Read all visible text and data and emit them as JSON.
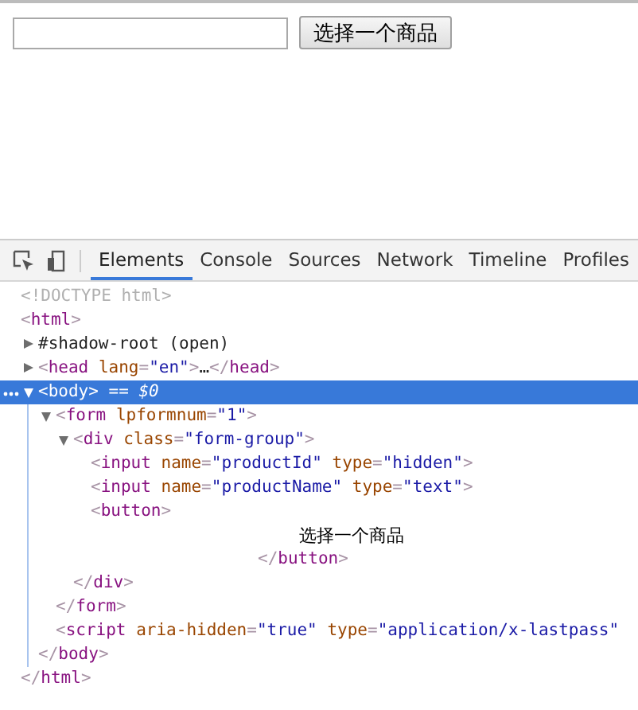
{
  "page": {
    "button": "选择一个商品"
  },
  "devtools": {
    "tabs": [
      {
        "label": "Elements",
        "selected": true
      },
      {
        "label": "Console",
        "selected": false
      },
      {
        "label": "Sources",
        "selected": false
      },
      {
        "label": "Network",
        "selected": false
      },
      {
        "label": "Timeline",
        "selected": false
      },
      {
        "label": "Profiles",
        "selected": false
      }
    ],
    "tree": [
      {
        "kind": "doctype",
        "selected": false,
        "text": "<!DOCTYPE html>"
      },
      {
        "kind": "element",
        "selected": false,
        "open": [
          {
            "kind": "punct",
            "text": "<"
          },
          {
            "kind": "tag",
            "text": "html"
          },
          {
            "kind": "punct",
            "text": ">"
          }
        ],
        "close": [
          {
            "kind": "punct",
            "text": "</"
          },
          {
            "kind": "tag",
            "text": "html"
          },
          {
            "kind": "punct",
            "text": ">"
          }
        ],
        "children": [
          {
            "kind": "shadow",
            "expanded": false,
            "selected": false,
            "text": "#shadow-root (open)"
          },
          {
            "kind": "element",
            "expanded": false,
            "selected": false,
            "open": [
              {
                "kind": "punct",
                "text": "<"
              },
              {
                "kind": "tag",
                "text": "head"
              },
              {
                "kind": "attr",
                "text": " lang"
              },
              {
                "kind": "punct",
                "text": "="
              },
              {
                "kind": "value",
                "text": "\"en\""
              },
              {
                "kind": "punct",
                "text": ">"
              },
              {
                "kind": "plain",
                "text": "…"
              },
              {
                "kind": "punct",
                "text": "</"
              },
              {
                "kind": "tag",
                "text": "head"
              },
              {
                "kind": "punct",
                "text": ">"
              }
            ]
          },
          {
            "kind": "element",
            "expanded": true,
            "selected": true,
            "suffix": " == $0",
            "open": [
              {
                "kind": "punct",
                "text": "<"
              },
              {
                "kind": "tag",
                "text": "body"
              },
              {
                "kind": "punct",
                "text": ">"
              }
            ],
            "close": [
              {
                "kind": "punct",
                "text": "</"
              },
              {
                "kind": "tag",
                "text": "body"
              },
              {
                "kind": "punct",
                "text": ">"
              }
            ],
            "children": [
              {
                "kind": "element",
                "expanded": true,
                "selected": false,
                "open": [
                  {
                    "kind": "punct",
                    "text": "<"
                  },
                  {
                    "kind": "tag",
                    "text": "form"
                  },
                  {
                    "kind": "attr",
                    "text": " lpformnum"
                  },
                  {
                    "kind": "punct",
                    "text": "="
                  },
                  {
                    "kind": "value",
                    "text": "\"1\""
                  },
                  {
                    "kind": "punct",
                    "text": ">"
                  }
                ],
                "close": [
                  {
                    "kind": "punct",
                    "text": "</"
                  },
                  {
                    "kind": "tag",
                    "text": "form"
                  },
                  {
                    "kind": "punct",
                    "text": ">"
                  }
                ],
                "children": [
                  {
                    "kind": "element",
                    "expanded": true,
                    "selected": false,
                    "open": [
                      {
                        "kind": "punct",
                        "text": "<"
                      },
                      {
                        "kind": "tag",
                        "text": "div"
                      },
                      {
                        "kind": "attr",
                        "text": " class"
                      },
                      {
                        "kind": "punct",
                        "text": "="
                      },
                      {
                        "kind": "value",
                        "text": "\"form-group\""
                      },
                      {
                        "kind": "punct",
                        "text": ">"
                      }
                    ],
                    "close": [
                      {
                        "kind": "punct",
                        "text": "</"
                      },
                      {
                        "kind": "tag",
                        "text": "div"
                      },
                      {
                        "kind": "punct",
                        "text": ">"
                      }
                    ],
                    "children": [
                      {
                        "kind": "element",
                        "selected": false,
                        "open": [
                          {
                            "kind": "punct",
                            "text": "<"
                          },
                          {
                            "kind": "tag",
                            "text": "input"
                          },
                          {
                            "kind": "attr",
                            "text": " name"
                          },
                          {
                            "kind": "punct",
                            "text": "="
                          },
                          {
                            "kind": "value",
                            "text": "\"productId\""
                          },
                          {
                            "kind": "attr",
                            "text": " type"
                          },
                          {
                            "kind": "punct",
                            "text": "="
                          },
                          {
                            "kind": "value",
                            "text": "\"hidden\""
                          },
                          {
                            "kind": "punct",
                            "text": ">"
                          }
                        ]
                      },
                      {
                        "kind": "element",
                        "selected": false,
                        "open": [
                          {
                            "kind": "punct",
                            "text": "<"
                          },
                          {
                            "kind": "tag",
                            "text": "input"
                          },
                          {
                            "kind": "attr",
                            "text": " name"
                          },
                          {
                            "kind": "punct",
                            "text": "="
                          },
                          {
                            "kind": "value",
                            "text": "\"productName\""
                          },
                          {
                            "kind": "attr",
                            "text": " type"
                          },
                          {
                            "kind": "punct",
                            "text": "="
                          },
                          {
                            "kind": "value",
                            "text": "\"text\""
                          },
                          {
                            "kind": "punct",
                            "text": ">"
                          }
                        ]
                      },
                      {
                        "kind": "element",
                        "selected": false,
                        "open": [
                          {
                            "kind": "punct",
                            "text": "<"
                          },
                          {
                            "kind": "tag",
                            "text": "button"
                          },
                          {
                            "kind": "punct",
                            "text": ">"
                          }
                        ],
                        "close": [
                          {
                            "kind": "punct",
                            "text": "</"
                          },
                          {
                            "kind": "tag",
                            "text": "button"
                          },
                          {
                            "kind": "punct",
                            "text": ">"
                          }
                        ],
                        "children": [
                          {
                            "kind": "text",
                            "selected": false,
                            "text": "选择一个商品"
                          }
                        ]
                      }
                    ]
                  }
                ]
              },
              {
                "kind": "element",
                "selected": false,
                "open": [
                  {
                    "kind": "punct",
                    "text": "<"
                  },
                  {
                    "kind": "tag",
                    "text": "script"
                  },
                  {
                    "kind": "attr",
                    "text": " aria-hidden"
                  },
                  {
                    "kind": "punct",
                    "text": "="
                  },
                  {
                    "kind": "value",
                    "text": "\"true\""
                  },
                  {
                    "kind": "attr",
                    "text": " type"
                  },
                  {
                    "kind": "punct",
                    "text": "="
                  },
                  {
                    "kind": "value",
                    "text": "\"application/x-lastpass\""
                  }
                ]
              }
            ]
          }
        ]
      }
    ]
  }
}
